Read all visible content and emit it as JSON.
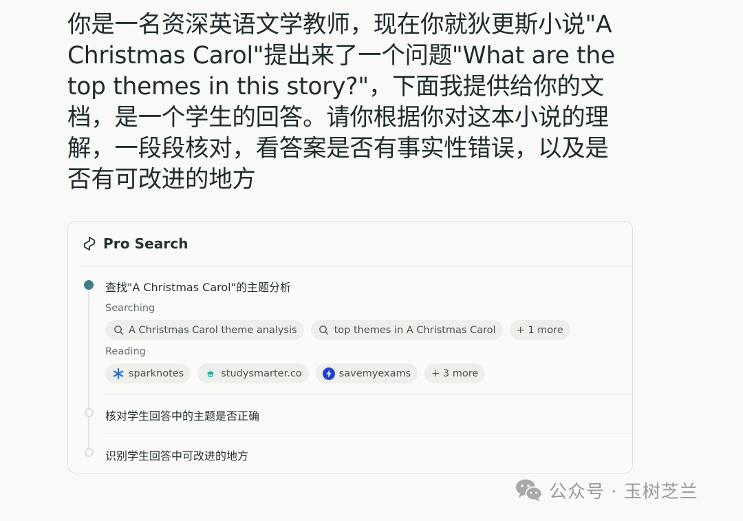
{
  "query": {
    "text": "你是一名资深英语文学教师，现在你就狄更斯小说\"A Christmas Carol\"提出来了一个问题\"What are the top themes in this story?\"，下面我提供给你的文档，是一个学生的回答。请你根据你对这本小说的理解，一段段核对，看答案是否有事实性错误，以及是否有可改进的地方"
  },
  "pro_search": {
    "title": "Pro Search",
    "icon": "perplexity-logo-icon",
    "steps": [
      {
        "label": "查找\"A Christmas Carol\"的主题分析",
        "status": "active",
        "searching_label": "Searching",
        "searches": [
          {
            "text": "A Christmas Carol theme analysis",
            "icon": "search-icon"
          },
          {
            "text": "top themes in A Christmas Carol",
            "icon": "search-icon"
          },
          {
            "text": "+ 1 more"
          }
        ],
        "reading_label": "Reading",
        "sources": [
          {
            "text": "sparknotes",
            "icon": "sparknotes-icon",
            "color": "#2f6fd0"
          },
          {
            "text": "studysmarter.co",
            "icon": "studysmarter-icon",
            "color": "#2fa58f"
          },
          {
            "text": "savemyexams",
            "icon": "savemyexams-icon",
            "color": "#1f3fd6"
          },
          {
            "text": "+ 3 more"
          }
        ]
      },
      {
        "label": "核对学生回答中的主题是否正确",
        "status": "pending"
      },
      {
        "label": "识别学生回答中可改进的地方",
        "status": "pending"
      }
    ]
  },
  "watermark": {
    "text": "公众号 · 玉树芝兰",
    "icon": "wechat-icon"
  },
  "colors": {
    "accent": "#3f7d86",
    "background": "#f9f9f7",
    "chip_bg": "#eeeeea"
  }
}
